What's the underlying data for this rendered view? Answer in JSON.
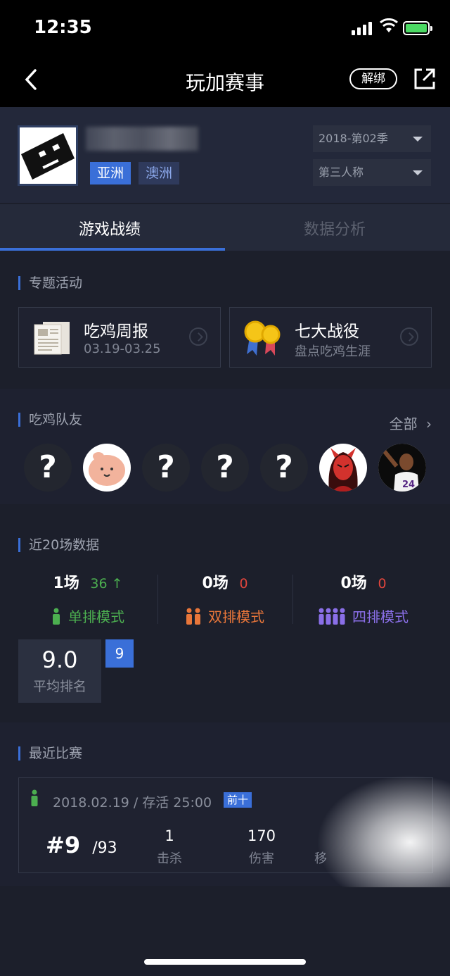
{
  "status_bar": {
    "time": "12:35"
  },
  "nav": {
    "title": "玩加赛事",
    "unbind_label": "解绑"
  },
  "profile": {
    "region_tags": [
      "亚洲",
      "澳洲"
    ],
    "season_select": "2018-第02季",
    "perspective_select": "第三人称"
  },
  "tabs": [
    {
      "label": "游戏战绩",
      "active": true
    },
    {
      "label": "数据分析",
      "active": false
    }
  ],
  "topics": {
    "title": "专题活动",
    "cards": [
      {
        "title": "吃鸡周报",
        "subtitle": "03.19-03.25",
        "icon": "newspaper-icon"
      },
      {
        "title": "七大战役",
        "subtitle": "盘点吃鸡生涯",
        "icon": "medal-icon"
      }
    ]
  },
  "teammates": {
    "title": "吃鸡队友",
    "all_label": "全部",
    "avatars": [
      "?",
      "pig-avatar",
      "?",
      "?",
      "?",
      "red-devil-avatar",
      "basketball-player-avatar"
    ]
  },
  "recent20": {
    "title": "近20场数据",
    "modes": [
      {
        "count": "1场",
        "delta": "36 ↑",
        "delta_color": "#4caf50",
        "label": "单排模式",
        "label_color": "#4caf50"
      },
      {
        "count": "0场",
        "delta": "0",
        "delta_color": "#e0453c",
        "label": "双排模式",
        "label_color": "#e8763a"
      },
      {
        "count": "0场",
        "delta": "0",
        "delta_color": "#e0453c",
        "label": "四排模式",
        "label_color": "#8a6fe8"
      }
    ],
    "avg_rank_value": "9.0",
    "avg_rank_label": "平均排名",
    "rank_badge": "9"
  },
  "recent_match": {
    "title": "最近比赛",
    "meta": "2018.02.19 / 存活 25:00",
    "badge": "前十",
    "rank": "#9",
    "total": "/93",
    "kills": "1",
    "kills_label": "击杀",
    "damage": "170",
    "damage_label": "伤害",
    "move_label": "移"
  }
}
